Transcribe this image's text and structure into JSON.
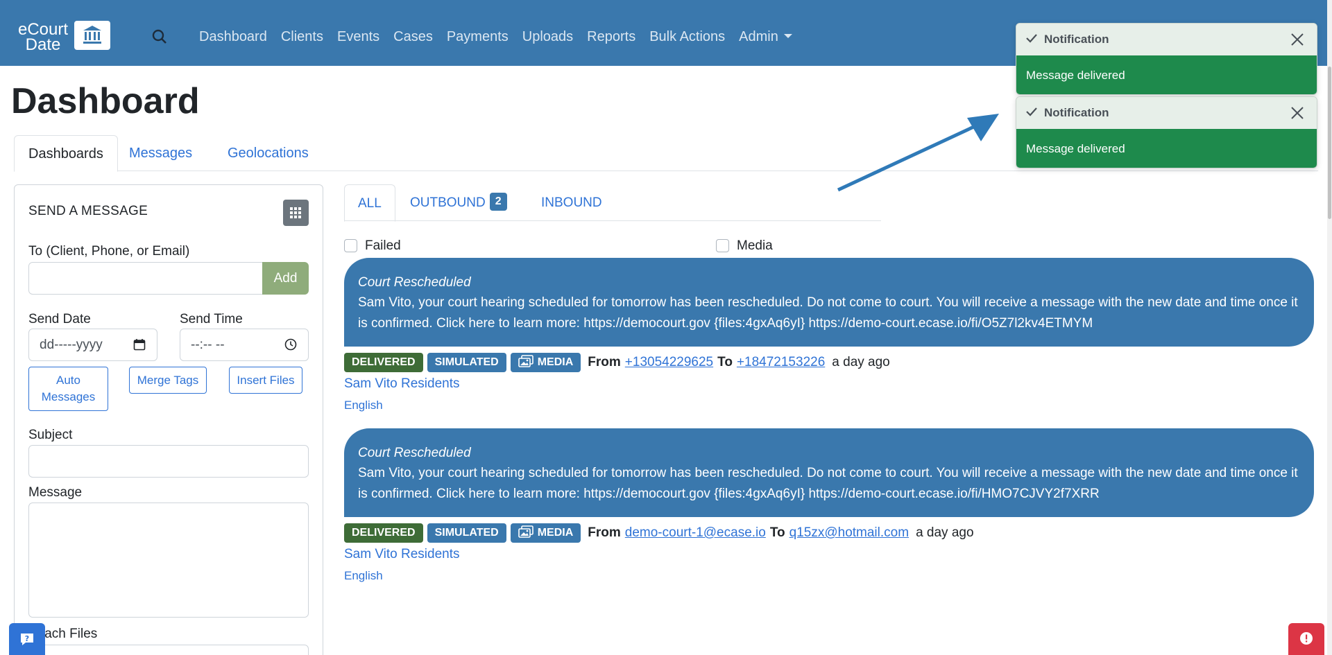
{
  "app": {
    "logo_line1": "eCourt",
    "logo_line2": "Date"
  },
  "nav": {
    "items": [
      "Dashboard",
      "Clients",
      "Events",
      "Cases",
      "Payments",
      "Uploads",
      "Reports",
      "Bulk Actions",
      "Admin"
    ]
  },
  "page": {
    "title": "Dashboard",
    "tabs": [
      "Dashboards",
      "Messages",
      "Geolocations"
    ]
  },
  "send_form": {
    "title": "SEND A MESSAGE",
    "to_label": "To (Client, Phone, or Email)",
    "to_value": "",
    "add_label": "Add",
    "send_date_label": "Send Date",
    "send_date_placeholder": "dd-----yyyy",
    "send_time_label": "Send Time",
    "send_time_placeholder": "--:-- --",
    "auto_messages_label": "Auto Messages",
    "merge_tags_label": "Merge Tags",
    "insert_files_label": "Insert Files",
    "subject_label": "Subject",
    "subject_value": "",
    "message_label": "Message",
    "message_value": "",
    "attach_label": "Attach Files"
  },
  "filters": {
    "tabs": [
      "ALL",
      "OUTBOUND",
      "INBOUND"
    ],
    "outbound_count": "2",
    "failed_label": "Failed",
    "media_label": "Media"
  },
  "messages": [
    {
      "subject": "Court Rescheduled",
      "body": "Sam Vito, your court hearing scheduled for tomorrow has been rescheduled. Do not come to court. You will receive a message with the new date and time once it is confirmed. Click here to learn more: https://democourt.gov {files:4gxAq6yI} https://demo-court.ecase.io/fi/O5Z7l2kv4ETMYM",
      "status": "DELIVERED",
      "mode": "SIMULATED",
      "media": "MEDIA",
      "from_label": "From",
      "from": "+13054229625",
      "to_label": "To",
      "to": "+18472153226",
      "time": "a day ago",
      "client": "Sam Vito Residents",
      "language": "English"
    },
    {
      "subject": "Court Rescheduled",
      "body": "Sam Vito, your court hearing scheduled for tomorrow has been rescheduled. Do not come to court. You will receive a message with the new date and time once it is confirmed. Click here to learn more: https://democourt.gov {files:4gxAq6yI} https://demo-court.ecase.io/fi/HMO7CJVY2f7XRR",
      "status": "DELIVERED",
      "mode": "SIMULATED",
      "media": "MEDIA",
      "from_label": "From",
      "from": "demo-court-1@ecase.io",
      "to_label": "To",
      "to": "q15zx@hotmail.com",
      "time": "a day ago",
      "client": "Sam Vito Residents",
      "language": "English"
    }
  ],
  "toasts": [
    {
      "title": "Notification",
      "body": "Message delivered"
    },
    {
      "title": "Notification",
      "body": "Message delivered"
    }
  ],
  "colors": {
    "navbar": "#3a78ad",
    "link": "#2f73d6",
    "delivered": "#3e6c37",
    "toast_body": "#1e8a4c",
    "alert": "#dc3545"
  }
}
